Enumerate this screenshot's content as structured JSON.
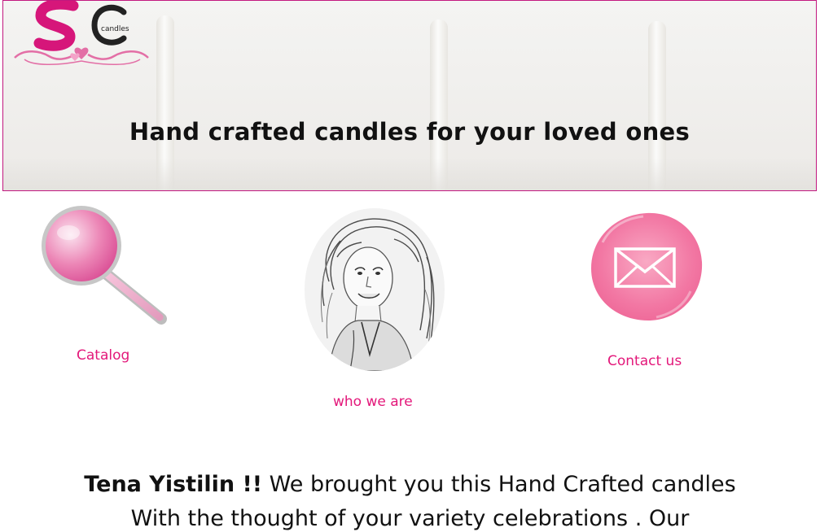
{
  "logo": {
    "text": "candles"
  },
  "hero": {
    "title": "Hand crafted candles for your loved ones"
  },
  "nav": {
    "catalog": {
      "label": "Catalog",
      "icon": "magnifier-icon"
    },
    "who": {
      "label": "who we are",
      "icon": "portrait-avatar"
    },
    "contact": {
      "label": "Contact us",
      "icon": "envelope-icon"
    }
  },
  "intro": {
    "greeting": "Tena Yistilin !!",
    "line1_rest": " We brought you this Hand Crafted candles",
    "line2": "With the thought of your variety celebrations . Our"
  },
  "colors": {
    "accent": "#e3187a",
    "border": "#c2187f",
    "text": "#111111"
  }
}
